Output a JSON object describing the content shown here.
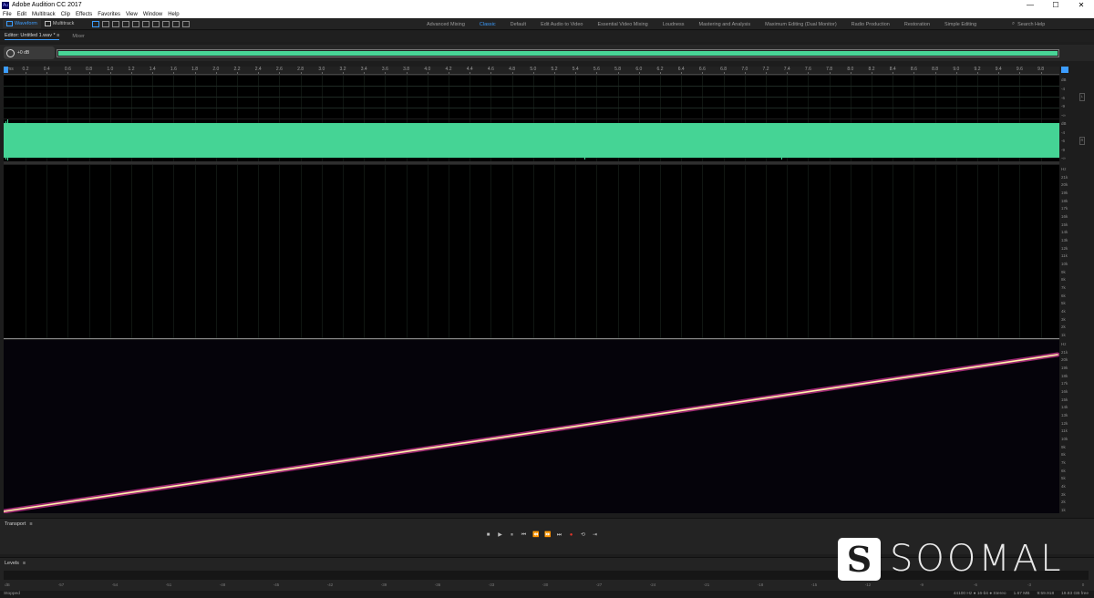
{
  "window": {
    "title": "Adobe Audition CC 2017",
    "controls": [
      "—",
      "☐",
      "✕"
    ]
  },
  "menu": [
    "File",
    "Edit",
    "Multitrack",
    "Clip",
    "Effects",
    "Favorites",
    "View",
    "Window",
    "Help"
  ],
  "toolbar": {
    "modes": [
      {
        "label": "Waveform",
        "active": true
      },
      {
        "label": "Multitrack",
        "active": false
      }
    ],
    "workspaces": [
      {
        "label": "Advanced Mixing",
        "active": false
      },
      {
        "label": "Classic",
        "active": true
      },
      {
        "label": "Default",
        "active": false
      },
      {
        "label": "Edit Audio to Video",
        "active": false
      },
      {
        "label": "Essential Video Mixing",
        "active": false
      },
      {
        "label": "Loudness",
        "active": false
      },
      {
        "label": "Mastering and Analysis",
        "active": false
      },
      {
        "label": "Maximum Editing (Dual Monitor)",
        "active": false
      },
      {
        "label": "Radio Production",
        "active": false
      },
      {
        "label": "Restoration",
        "active": false
      },
      {
        "label": "Simple Editing",
        "active": false
      }
    ],
    "search_placeholder": "Search Help"
  },
  "editor": {
    "tab_label": "Editor: Untitled 1.wav *",
    "mixer_label": "Mixer",
    "hud_value": "+0 dB"
  },
  "ruler": {
    "start_label": "hms",
    "ticks": [
      "0.2",
      "0.4",
      "0.6",
      "0.8",
      "1.0",
      "1.2",
      "1.4",
      "1.6",
      "1.8",
      "2.0",
      "2.2",
      "2.4",
      "2.6",
      "2.8",
      "3.0",
      "3.2",
      "3.4",
      "3.6",
      "3.8",
      "4.0",
      "4.2",
      "4.4",
      "4.6",
      "4.8",
      "5.0",
      "5.2",
      "5.4",
      "5.6",
      "5.8",
      "6.0",
      "6.2",
      "6.4",
      "6.6",
      "6.8",
      "7.0",
      "7.2",
      "7.4",
      "7.6",
      "7.8",
      "8.0",
      "8.2",
      "8.4",
      "8.6",
      "8.8",
      "9.0",
      "9.2",
      "9.4",
      "9.6",
      "9.8"
    ]
  },
  "waveform_scale": {
    "ch1": [
      "dB",
      "-4",
      "-6",
      "-9",
      "-∞"
    ],
    "ch2": [
      "dB",
      "-4",
      "-6",
      "-9",
      "-∞"
    ],
    "pan_ch1": "L",
    "pan_ch2": "R"
  },
  "spectral_scale": {
    "ch1": [
      "Hz",
      "21k",
      "20k",
      "19k",
      "18k",
      "17k",
      "16k",
      "15k",
      "14k",
      "13k",
      "12k",
      "11k",
      "10k",
      "9k",
      "8k",
      "7k",
      "6k",
      "5k",
      "4k",
      "3k",
      "2k",
      "1k"
    ],
    "ch2": [
      "Hz",
      "21k",
      "20k",
      "19k",
      "18k",
      "17k",
      "16k",
      "15k",
      "14k",
      "13k",
      "12k",
      "11k",
      "10k",
      "9k",
      "8k",
      "7k",
      "6k",
      "5k",
      "4k",
      "3k",
      "2k",
      "1k"
    ]
  },
  "sweep": {
    "start_frequency_label": "1k",
    "end_frequency_label": "21k",
    "color_core": "#fff3a8",
    "color_glow": "#c0308a"
  },
  "colors": {
    "waveform": "#45d495",
    "accent": "#3c9dff",
    "record": "#e0352b"
  },
  "transport": {
    "title": "Transport",
    "buttons": [
      "■",
      "▶",
      "⏸",
      "⏮",
      "⏪",
      "⏩",
      "⏭",
      "●",
      "⟲",
      "⇥"
    ]
  },
  "levels": {
    "title": "Levels",
    "scale": [
      "dB",
      "-57",
      "-54",
      "-51",
      "-48",
      "-45",
      "-42",
      "-39",
      "-36",
      "-33",
      "-30",
      "-27",
      "-24",
      "-21",
      "-18",
      "-15",
      "-12",
      "-9",
      "-6",
      "-3",
      "0"
    ]
  },
  "status": {
    "state": "Stopped",
    "format": "44100 Hz ● 16-bit ● Stereo",
    "file_size": "1.67 MB",
    "duration": "9:59.918",
    "free_space": "19.83 GB free"
  },
  "watermark": {
    "logo_glyph": "S",
    "text": "SOOMAL"
  }
}
